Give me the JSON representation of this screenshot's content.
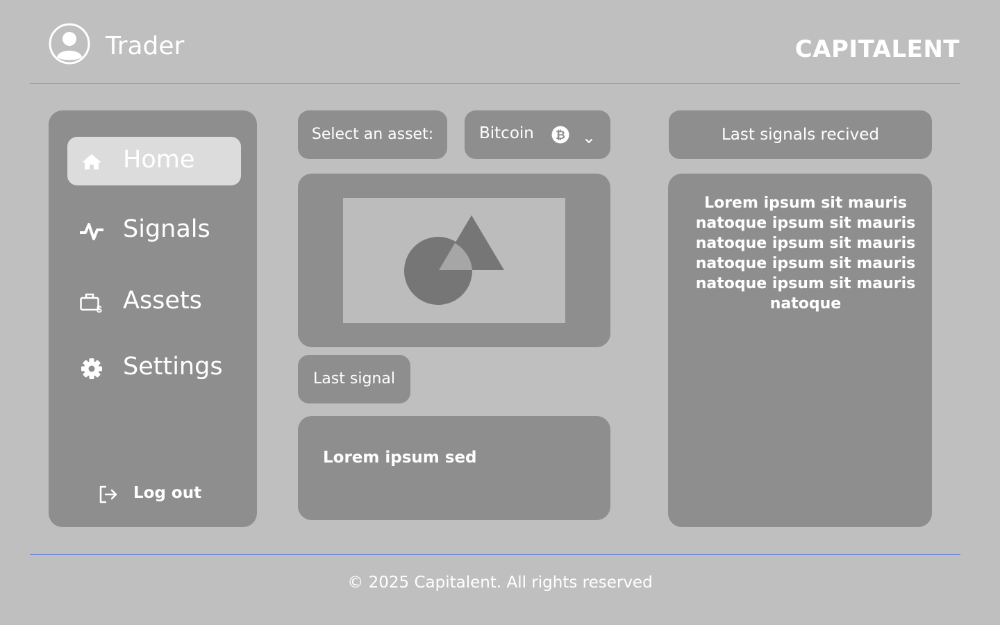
{
  "header": {
    "user_label": "Trader",
    "brand": "CAPITALENT",
    "icons": {
      "user": "user-circle-icon"
    }
  },
  "sidebar": {
    "items": [
      {
        "label": "Home",
        "icon": "home-icon",
        "active": true
      },
      {
        "label": "Signals",
        "icon": "activity-icon",
        "active": false
      },
      {
        "label": "Assets",
        "icon": "briefcase-dollar-icon",
        "active": false
      },
      {
        "label": "Settings",
        "icon": "gear-icon",
        "active": false
      }
    ],
    "logout": {
      "label": "Log out",
      "icon": "logout-icon"
    }
  },
  "asset_selector": {
    "label": "Select an asset:",
    "selected": "Bitcoin",
    "icons": {
      "coin": "bitcoin-icon",
      "chevron": "chevron-down-icon"
    }
  },
  "image_placeholder": {
    "icon": "image-placeholder-icon"
  },
  "last_signal": {
    "label": "Last signal",
    "text": "Lorem ipsum sed"
  },
  "signals_panel": {
    "header": "Last signals recived",
    "text": "Lorem ipsum sit mauris natoque ipsum sit mauris natoque ipsum sit mauris natoque ipsum sit mauris natoque ipsum sit mauris natoque"
  },
  "footer": {
    "copyright": "© 2025 Capitalent. All rights reserved"
  },
  "colors": {
    "background": "#bfbfbf",
    "panel": "#8e8e8e",
    "active_nav": "#dcdcdc",
    "rule": "#6f8fd6",
    "text": "#ffffff"
  }
}
